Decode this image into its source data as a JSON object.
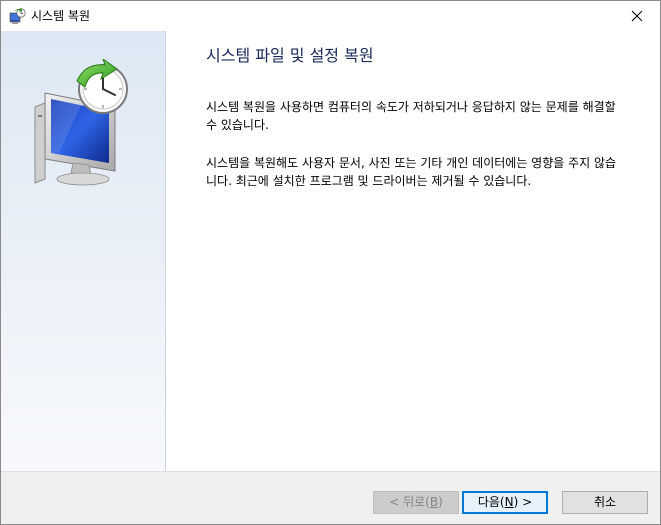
{
  "window": {
    "title": "시스템 복원"
  },
  "icons": {
    "title_icon": "system-restore-icon",
    "hero_icon": "monitor-clock-restore-icon",
    "close_icon": "close-icon"
  },
  "content": {
    "heading": "시스템 파일 및 설정 복원",
    "paragraph1": "시스템 복원을 사용하면 컴퓨터의 속도가 저하되거나 응답하지 않는 문제를 해결할 수 있습니다.",
    "paragraph2": "시스템을 복원해도 사용자 문서, 사진 또는 기타 개인 데이터에는 영향을 주지 않습니다. 최근에 설치한 프로그램 및 드라이버는 제거될 수 있습니다."
  },
  "footer": {
    "back_label_prefix": "< 뒤로(",
    "back_accel": "B",
    "back_label_suffix": ")",
    "next_label_prefix": "다음(",
    "next_accel": "N",
    "next_label_suffix": ") >",
    "cancel_label": "취소"
  },
  "colors": {
    "accent": "#0078d7",
    "heading": "#1a2a5a",
    "panel_top": "#dde8f4",
    "disabled_text": "#838383"
  }
}
